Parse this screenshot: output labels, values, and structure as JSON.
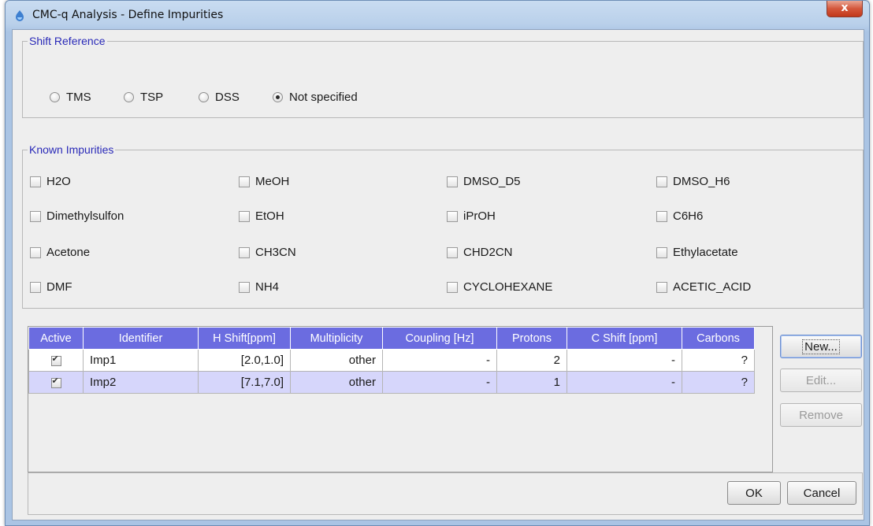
{
  "window": {
    "title": "CMC-q Analysis - Define Impurities",
    "close_glyph": "x"
  },
  "shift_reference": {
    "legend": "Shift Reference",
    "options": [
      {
        "label": "TMS",
        "selected": false
      },
      {
        "label": "TSP",
        "selected": false
      },
      {
        "label": "DSS",
        "selected": false
      },
      {
        "label": "Not specified",
        "selected": true
      }
    ]
  },
  "known_impurities": {
    "legend": "Known Impurities",
    "items": [
      {
        "label": "H2O",
        "checked": false
      },
      {
        "label": "MeOH",
        "checked": false
      },
      {
        "label": "DMSO_D5",
        "checked": false
      },
      {
        "label": "DMSO_H6",
        "checked": false
      },
      {
        "label": "Dimethylsulfon",
        "checked": false
      },
      {
        "label": "EtOH",
        "checked": false
      },
      {
        "label": "iPrOH",
        "checked": false
      },
      {
        "label": "C6H6",
        "checked": false
      },
      {
        "label": "Acetone",
        "checked": false
      },
      {
        "label": "CH3CN",
        "checked": false
      },
      {
        "label": "CHD2CN",
        "checked": false
      },
      {
        "label": "Ethylacetate",
        "checked": false
      },
      {
        "label": "DMF",
        "checked": false
      },
      {
        "label": "NH4",
        "checked": false
      },
      {
        "label": "CYCLOHEXANE",
        "checked": false
      },
      {
        "label": "ACETIC_ACID",
        "checked": false
      }
    ]
  },
  "table": {
    "columns": [
      "Active",
      "Identifier",
      "H Shift[ppm]",
      "Multiplicity",
      "Coupling [Hz]",
      "Protons",
      "C Shift [ppm]",
      "Carbons"
    ],
    "rows": [
      {
        "active": true,
        "identifier": "Imp1",
        "h_shift": "[2.0,1.0]",
        "multiplicity": "other",
        "coupling": "-",
        "protons": "2",
        "c_shift": "-",
        "carbons": "?"
      },
      {
        "active": true,
        "identifier": "Imp2",
        "h_shift": "[7.1,7.0]",
        "multiplicity": "other",
        "coupling": "-",
        "protons": "1",
        "c_shift": "-",
        "carbons": "?"
      }
    ]
  },
  "side_buttons": {
    "new": "New...",
    "edit": "Edit...",
    "remove": "Remove"
  },
  "footer": {
    "ok": "OK",
    "cancel": "Cancel"
  },
  "colors": {
    "header_bg": "#6b6ce0",
    "selected_row": "#d6d6fb",
    "legend_text": "#2a2ab8"
  }
}
